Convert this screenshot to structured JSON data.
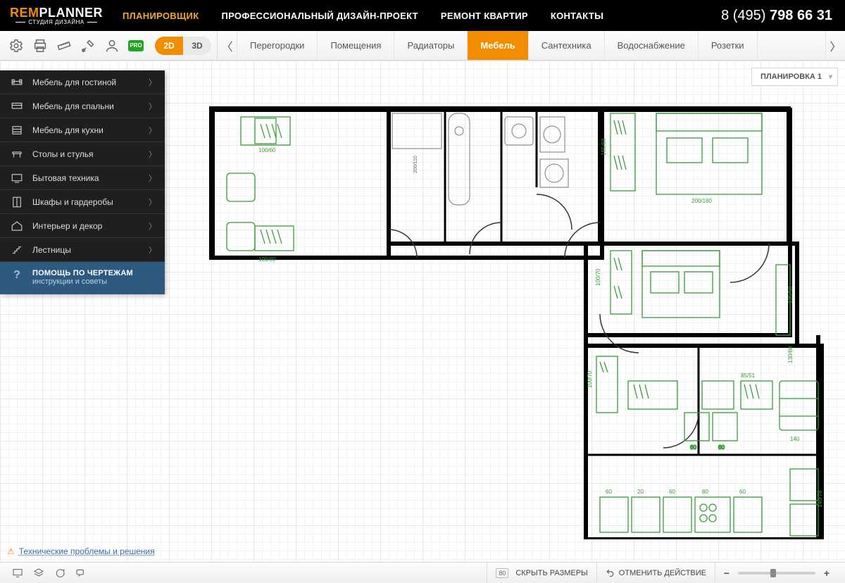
{
  "header": {
    "logo_rem": "REM",
    "logo_planner": "PLANNER",
    "logo_sub": "СТУДИЯ ДИЗАЙНА",
    "nav": [
      {
        "label": "ПЛАНИРОВЩИК",
        "active": true
      },
      {
        "label": "ПРОФЕССИОНАЛЬНЫЙ ДИЗАЙН-ПРОЕКТ",
        "active": false
      },
      {
        "label": "РЕМОНТ КВАРТИР",
        "active": false
      },
      {
        "label": "КОНТАКТЫ",
        "active": false
      }
    ],
    "phone_prefix": "8 (495) ",
    "phone_bold": "798 66 31"
  },
  "toolbar": {
    "pro": "PRO",
    "view2d": "2D",
    "view3d": "3D",
    "tabs": [
      {
        "label": "Перегородки",
        "active": false
      },
      {
        "label": "Помещения",
        "active": false
      },
      {
        "label": "Радиаторы",
        "active": false
      },
      {
        "label": "Мебель",
        "active": true
      },
      {
        "label": "Сантехника",
        "active": false
      },
      {
        "label": "Водоснабжение",
        "active": false
      },
      {
        "label": "Розетки",
        "active": false
      }
    ]
  },
  "sidebar": {
    "items": [
      {
        "label": "Мебель для гостиной"
      },
      {
        "label": "Мебель для спальни"
      },
      {
        "label": "Мебель для кухни"
      },
      {
        "label": "Столы и стулья"
      },
      {
        "label": "Бытовая техника"
      },
      {
        "label": "Шкафы и гардеробы"
      },
      {
        "label": "Интерьер и декор"
      },
      {
        "label": "Лестницы"
      }
    ],
    "help_title": "ПОМОЩЬ ПО ЧЕРТЕЖАМ",
    "help_sub": "инструкции и советы",
    "help_q": "?"
  },
  "layout_dd": "ПЛАНИРОВКА 1",
  "issues_link": "Технические проблемы и решения",
  "bottom": {
    "scale": "80",
    "hide_sizes": "СКРЫТЬ РАЗМЕРЫ",
    "undo": "ОТМЕНИТЬ ДЕЙСТВИЕ"
  },
  "plan": {
    "dims": [
      "100/60",
      "100/60",
      "200/110",
      "165/68",
      "200/180",
      "135/50",
      "130/60",
      "100/70",
      "100/70",
      "85/51",
      "140",
      "60",
      "60",
      "60",
      "80",
      "60",
      "140/78",
      "60",
      "20",
      "60",
      "60"
    ]
  }
}
